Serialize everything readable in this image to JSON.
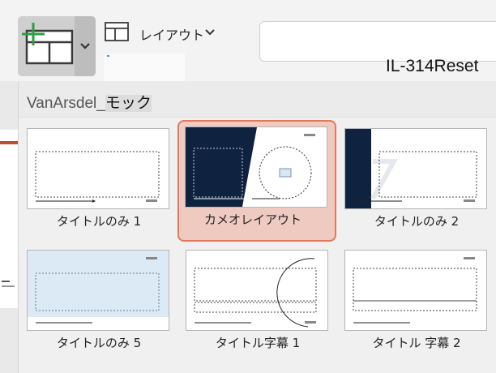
{
  "ribbon": {
    "new_slide_icon": "new-slide-plus-icon",
    "layout_label": "レイアウト",
    "doc_id": "IL-314Reset"
  },
  "gallery": {
    "title_main": "VanArsdel_",
    "title_selected": "モック",
    "layouts": [
      {
        "label": "タイトルのみ 1",
        "thumb": "title-only-1"
      },
      {
        "label": "カメオレイアウト",
        "thumb": "cameo-layout",
        "selected": true
      },
      {
        "label": "タイトルのみ 2",
        "thumb": "title-only-2"
      },
      {
        "label": "タイトルのみ 5",
        "thumb": "title-only-5"
      },
      {
        "label": "タイトル字幕 1",
        "thumb": "title-subtitle-1"
      },
      {
        "label": "タイトル 字幕 2",
        "thumb": "title-subtitle-2"
      }
    ],
    "thumb_logo": "VanArsdel"
  },
  "colors": {
    "accent_green": "#2e9e3e",
    "selection_border": "#e07a5f",
    "selection_fill": "#eecac0",
    "navy": "#0f2340",
    "light_blue": "#dceaf6"
  }
}
